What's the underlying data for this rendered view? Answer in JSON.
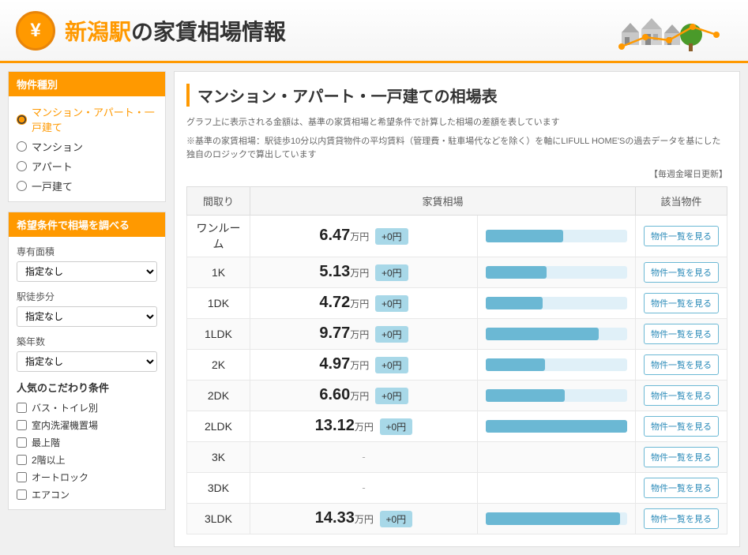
{
  "header": {
    "title_pre": "新潟駅",
    "title_post": "の家賃相場情報",
    "yen_symbol": "¥"
  },
  "sidebar": {
    "property_type": {
      "section_title": "物件種別",
      "options": [
        {
          "label": "マンション・アパート・一戸建て",
          "value": "all",
          "selected": true
        },
        {
          "label": "マンション",
          "value": "mansion",
          "selected": false
        },
        {
          "label": "アパート",
          "value": "apartment",
          "selected": false
        },
        {
          "label": "一戸建て",
          "value": "house",
          "selected": false
        }
      ]
    },
    "search": {
      "section_title": "希望条件で相場を調べる",
      "area_label": "専有面積",
      "area_placeholder": "指定なし",
      "area_options": [
        "指定なし"
      ],
      "walk_label": "駅徒歩分",
      "walk_placeholder": "指定なし",
      "walk_options": [
        "指定なし"
      ],
      "age_label": "築年数",
      "age_placeholder": "指定なし",
      "age_options": [
        "指定なし"
      ],
      "popular_title": "人気のこだわり条件",
      "checkboxes": [
        {
          "label": "バス・トイレ別",
          "checked": false
        },
        {
          "label": "室内洗濯機置場",
          "checked": false
        },
        {
          "label": "最上階",
          "checked": false
        },
        {
          "label": "2階以上",
          "checked": false
        },
        {
          "label": "オートロック",
          "checked": false
        },
        {
          "label": "エアコン",
          "checked": false
        }
      ]
    }
  },
  "content": {
    "title": "マンション・アパート・一戸建ての相場表",
    "note1": "グラフ上に表示される金額は、基準の家賃相場と希望条件で計算した相場の差額を表しています",
    "note2": "※基準の家賃相場：駅徒歩10分以内賃貸物件の平均賃料（管理費・駐車場代などを除く）を軸にLIFULL HOME'Sの過去データを基にした独自のロジックで算出しています",
    "update_note": "【毎週金曜日更新】",
    "table": {
      "col_room": "間取り",
      "col_rent": "家賃相場",
      "col_property": "該当物件",
      "btn_label": "物件一覧を見る",
      "rows": [
        {
          "type": "ワンルーム",
          "price": "6.47",
          "unit": "万円",
          "diff": "+0円",
          "bar_pct": 55,
          "has_data": true
        },
        {
          "type": "1K",
          "price": "5.13",
          "unit": "万円",
          "diff": "+0円",
          "bar_pct": 43,
          "has_data": true
        },
        {
          "type": "1DK",
          "price": "4.72",
          "unit": "万円",
          "diff": "+0円",
          "bar_pct": 40,
          "has_data": true
        },
        {
          "type": "1LDK",
          "price": "9.77",
          "unit": "万円",
          "diff": "+0円",
          "bar_pct": 80,
          "has_data": true
        },
        {
          "type": "2K",
          "price": "4.97",
          "unit": "万円",
          "diff": "+0円",
          "bar_pct": 42,
          "has_data": true
        },
        {
          "type": "2DK",
          "price": "6.60",
          "unit": "万円",
          "diff": "+0円",
          "bar_pct": 56,
          "has_data": true
        },
        {
          "type": "2LDK",
          "price": "13.12",
          "unit": "万円",
          "diff": "+0円",
          "bar_pct": 100,
          "has_data": true
        },
        {
          "type": "3K",
          "price": null,
          "unit": "",
          "diff": "",
          "bar_pct": 0,
          "has_data": false
        },
        {
          "type": "3DK",
          "price": null,
          "unit": "",
          "diff": "",
          "bar_pct": 0,
          "has_data": false
        },
        {
          "type": "3LDK",
          "price": "14.33",
          "unit": "万円",
          "diff": "+0円",
          "bar_pct": 95,
          "has_data": true
        }
      ]
    }
  }
}
